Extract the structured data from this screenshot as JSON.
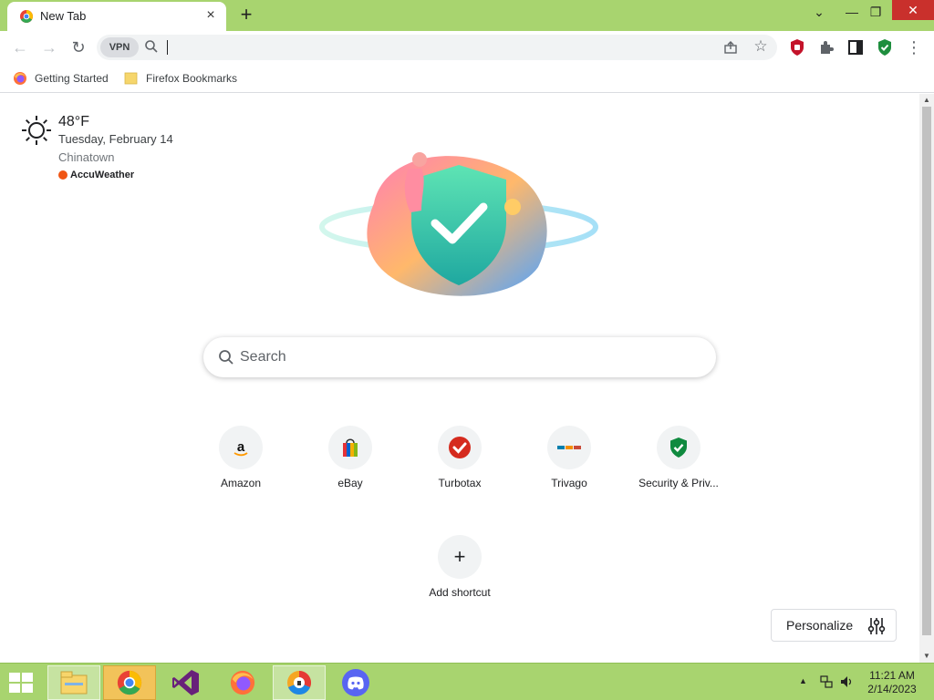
{
  "tab": {
    "title": "New Tab",
    "close_glyph": "×"
  },
  "new_tab_glyph": "+",
  "window_controls": {
    "chevron": "⌄",
    "minimize": "—",
    "restore": "❐",
    "close": "✕"
  },
  "toolbar": {
    "back_glyph": "←",
    "forward_glyph": "→",
    "reload_glyph": "↻",
    "vpn_label": "VPN",
    "address_value": "",
    "star_glyph": "☆",
    "menu_glyph": "⋮"
  },
  "bookmarks": [
    {
      "label": "Getting Started",
      "icon": "firefox-icon"
    },
    {
      "label": "Firefox Bookmarks",
      "icon": "folder-icon"
    }
  ],
  "weather": {
    "temperature": "48°F",
    "date": "Tuesday, February 14",
    "location": "Chinatown",
    "provider": "AccuWeather"
  },
  "search": {
    "placeholder": "Search"
  },
  "shortcuts": [
    {
      "label": "Amazon",
      "icon": "amazon-icon"
    },
    {
      "label": "eBay",
      "icon": "ebay-icon"
    },
    {
      "label": "Turbotax",
      "icon": "turbotax-icon"
    },
    {
      "label": "Trivago",
      "icon": "trivago-icon"
    },
    {
      "label": "Security & Priv...",
      "icon": "shield-check-icon"
    }
  ],
  "add_shortcut": {
    "label": "Add shortcut",
    "glyph": "+"
  },
  "personalize": {
    "label": "Personalize"
  },
  "taskbar": {
    "apps": [
      "file-explorer-icon",
      "chrome-icon",
      "visual-studio-icon",
      "firefox-icon",
      "secure-browser-icon",
      "discord-icon"
    ],
    "time": "11:21 AM",
    "date": "2/14/2023"
  },
  "colors": {
    "accent_green": "#a8d46f",
    "close_red": "#c9302c"
  }
}
